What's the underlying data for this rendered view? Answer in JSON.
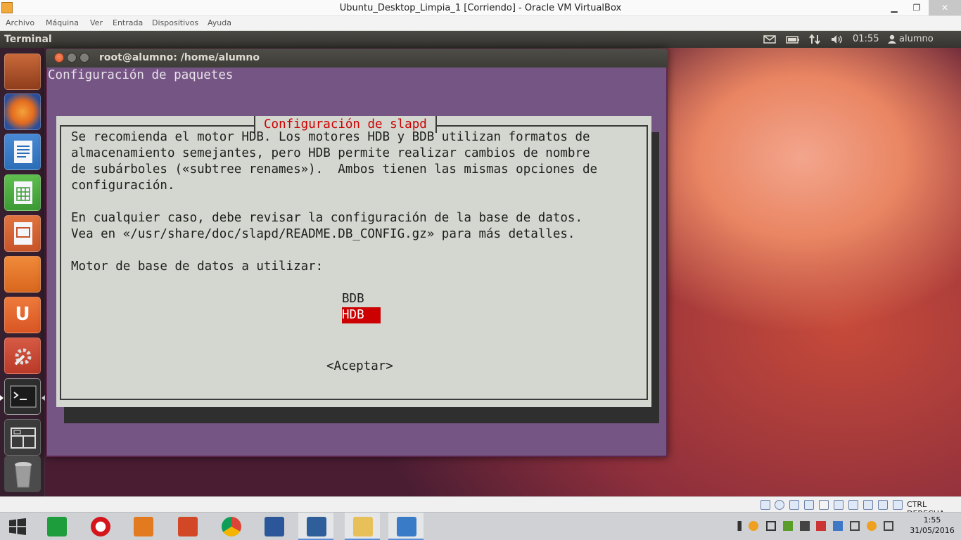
{
  "host_window": {
    "title": "Ubuntu_Desktop_Limpia_1 [Corriendo] - Oracle VM VirtualBox",
    "menu": [
      "Archivo",
      "Máquina",
      "Ver",
      "Entrada",
      "Dispositivos",
      "Ayuda"
    ],
    "controls": {
      "minimize": "▁",
      "restore": "❐",
      "close": "✕"
    }
  },
  "ubuntu_panel": {
    "app_name": "Terminal",
    "clock": "01:55",
    "user": "alumno",
    "indicators": [
      "mail-icon",
      "battery-icon",
      "network-icon",
      "volume-icon"
    ]
  },
  "launcher": {
    "items": [
      {
        "name": "files",
        "color": "#b5552b",
        "glyph": ""
      },
      {
        "name": "firefox",
        "color": "#e36b1f",
        "glyph": ""
      },
      {
        "name": "libreoffice-writer",
        "color": "#2b6eb8",
        "glyph": ""
      },
      {
        "name": "libreoffice-calc",
        "color": "#3d9a35",
        "glyph": ""
      },
      {
        "name": "libreoffice-impress",
        "color": "#c8552a",
        "glyph": ""
      },
      {
        "name": "software-center",
        "color": "#d9671e",
        "glyph": ""
      },
      {
        "name": "ubuntu-one",
        "color": "#d95624",
        "glyph": "U"
      },
      {
        "name": "system-settings",
        "color": "#b93a28",
        "glyph": ""
      },
      {
        "name": "terminal",
        "color": "#2e2e2e",
        "glyph": ""
      },
      {
        "name": "workspace-switcher",
        "color": "#3b3b3b",
        "glyph": ""
      },
      {
        "name": "trash",
        "color": "#5a5a5a",
        "glyph": ""
      }
    ]
  },
  "terminal": {
    "title": "root@alumno: /home/alumno",
    "header_line": "Configuración de paquetes",
    "dialog": {
      "title": "Configuración de slapd",
      "paragraph1": [
        "Se recomienda el motor HDB. Los motores HDB y BDB utilizan formatos de",
        "almacenamiento semejantes, pero HDB permite realizar cambios de nombre",
        "de subárboles («subtree renames»).  Ambos tienen las mismas opciones de",
        "configuración."
      ],
      "paragraph2": [
        "En cualquier caso, debe revisar la configuración de la base de datos.",
        "Vea en «/usr/share/doc/slapd/README.DB_CONFIG.gz» para más detalles."
      ],
      "prompt": "Motor de base de datos a utilizar:",
      "options": [
        "BDB",
        "HDB"
      ],
      "selected_option": "HDB",
      "ok_button": "<Aceptar>"
    }
  },
  "vb_status": {
    "host_key": "CTRL DERECHA"
  },
  "taskbar": {
    "clock_time": "1:55",
    "clock_date": "31/05/2016",
    "items": [
      {
        "name": "start",
        "color": "#ffffff"
      },
      {
        "name": "store",
        "color": "#1e9d3c"
      },
      {
        "name": "opera",
        "color": "#d4161c"
      },
      {
        "name": "media-player",
        "color": "#e37a1f"
      },
      {
        "name": "powerpoint",
        "color": "#d24726"
      },
      {
        "name": "chrome",
        "color": "#4285f4"
      },
      {
        "name": "word",
        "color": "#2b579a"
      },
      {
        "name": "virtualbox",
        "color": "#2e5f9a"
      },
      {
        "name": "file-explorer",
        "color": "#e8c05a"
      },
      {
        "name": "photos",
        "color": "#3a7bc8"
      }
    ]
  }
}
